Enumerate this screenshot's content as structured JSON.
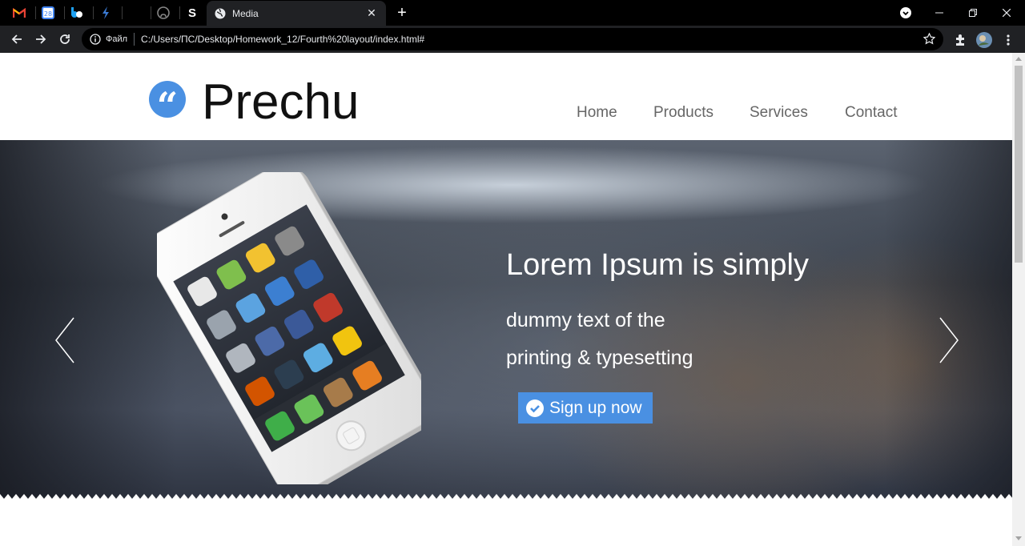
{
  "browser": {
    "pinned_tabs": [
      {
        "icon": "gmail-icon",
        "glyph": "M"
      },
      {
        "icon": "calendar-icon",
        "glyph": "28"
      },
      {
        "icon": "bluesky-icon",
        "glyph": "b"
      },
      {
        "icon": "bolt-icon",
        "glyph": "⚡"
      },
      {
        "icon": "blank-tab-icon",
        "glyph": ""
      },
      {
        "icon": "github-icon",
        "glyph": "◯"
      },
      {
        "icon": "s-app-icon",
        "glyph": "S"
      }
    ],
    "active_tab": {
      "title": "Media",
      "icon": "globe-icon"
    },
    "omnibox": {
      "info_label": "Файл",
      "url": "C:/Users/ПС/Desktop/Homework_12/Fourth%20layout/index.html#"
    }
  },
  "site": {
    "brand": "Prechu",
    "logo_glyph": "“",
    "nav": [
      "Home",
      "Products",
      "Services",
      "Contact"
    ]
  },
  "hero": {
    "title": "Lorem Ipsum is simply",
    "line1": "dummy text of the",
    "line2": "printing & typesetting",
    "cta_label": "Sign up now"
  },
  "colors": {
    "accent": "#4a90e2",
    "browser_bg": "#000000",
    "toolbar_bg": "#202124"
  }
}
